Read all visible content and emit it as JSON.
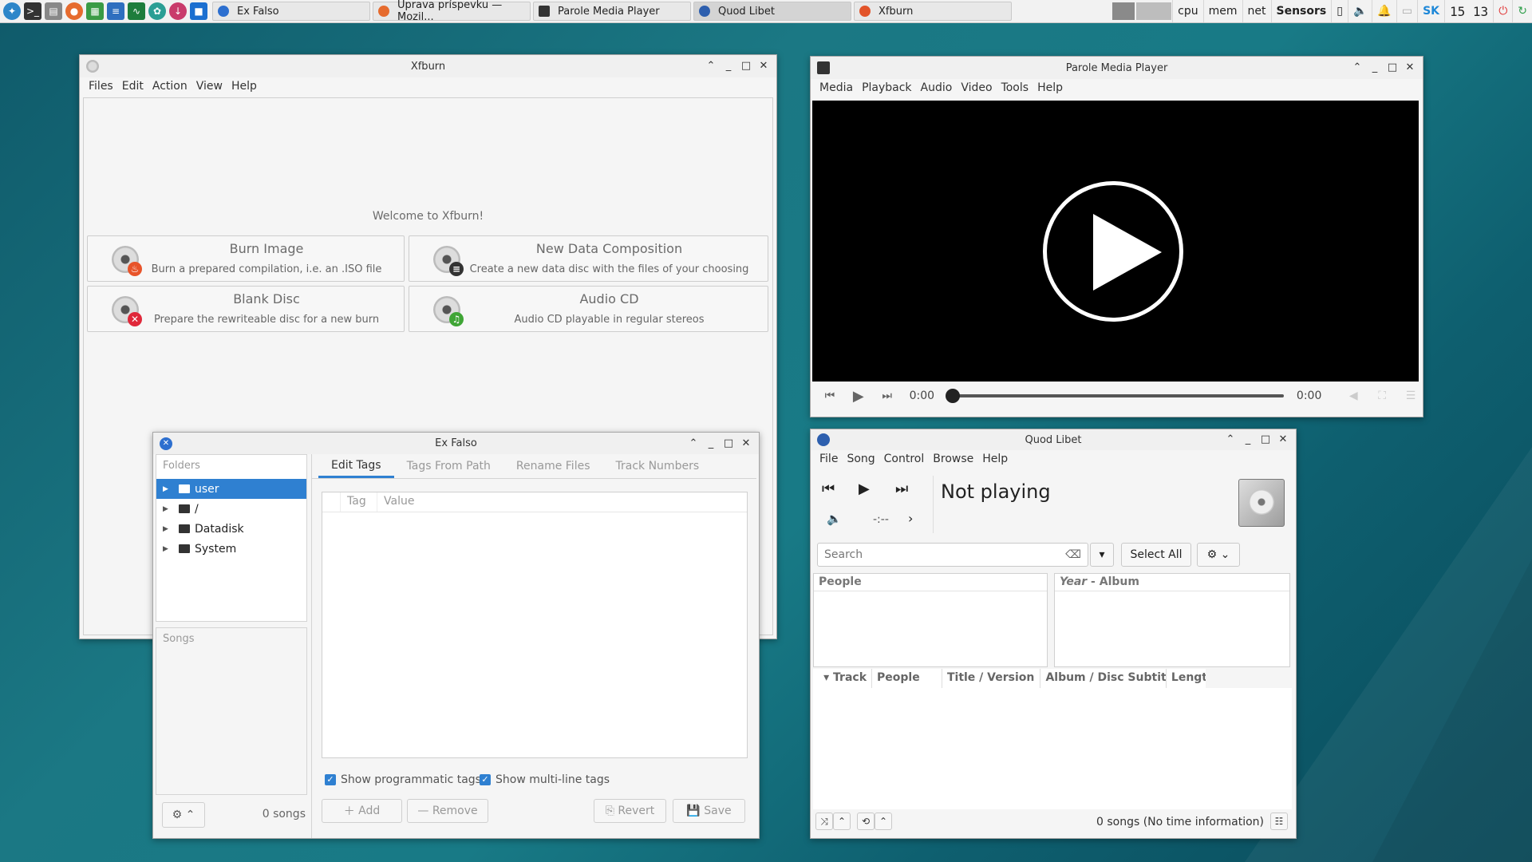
{
  "taskbar": {
    "launchers": [
      "app-menu-icon",
      "terminal-icon",
      "file-manager-icon",
      "firefox-icon",
      "spreadsheet-icon",
      "document-icon",
      "activity-monitor-icon",
      "settings-icon",
      "download-icon",
      "desktop-icon"
    ],
    "tasks": [
      {
        "label": "Ex Falso",
        "icon": "exfalso-icon",
        "color": "#2d6fcf"
      },
      {
        "label": "Úprava príspevku — Mozil...",
        "icon": "firefox-icon",
        "color": "#e66b2e"
      },
      {
        "label": "Parole Media Player",
        "icon": "parole-icon",
        "color": "#333333"
      },
      {
        "label": "Quod Libet",
        "icon": "quodlibet-icon",
        "color": "#2d5fae"
      },
      {
        "label": "Xfburn",
        "icon": "xfburn-icon",
        "color": "#e2542a"
      }
    ],
    "tray": {
      "cpu": "cpu",
      "mem": "mem",
      "net": "net",
      "sensors": "Sensors",
      "keyboard_layout": "SK",
      "clock": "15 13"
    }
  },
  "xfburn": {
    "title": "Xfburn",
    "menu": [
      "Files",
      "Edit",
      "Action",
      "View",
      "Help"
    ],
    "welcome": "Welcome to Xfburn!",
    "cards": [
      {
        "title": "Burn Image",
        "desc": "Burn a prepared compilation, i.e. an .ISO file"
      },
      {
        "title": "New Data Composition",
        "desc": "Create a new data disc with the files of your choosing"
      },
      {
        "title": "Blank Disc",
        "desc": "Prepare the rewriteable disc for a new burn"
      },
      {
        "title": "Audio CD",
        "desc": "Audio CD playable in regular stereos"
      }
    ]
  },
  "parole": {
    "title": "Parole Media Player",
    "menu": [
      "Media",
      "Playback",
      "Audio",
      "Video",
      "Tools",
      "Help"
    ],
    "elapsed": "0:00",
    "duration": "0:00",
    "progress": 0
  },
  "exfalso": {
    "title": "Ex Falso",
    "folders_label": "Folders",
    "folders": [
      "user",
      "/",
      "Datadisk",
      "System"
    ],
    "songs_label": "Songs",
    "songs_count": "0 songs",
    "tabs": [
      "Edit Tags",
      "Tags From Path",
      "Rename Files",
      "Track Numbers"
    ],
    "tag_col": "Tag",
    "value_col": "Value",
    "show_programmatic": "Show programmatic tags",
    "show_multiline": "Show multi-line tags",
    "add": "Add",
    "remove": "Remove",
    "revert": "Revert",
    "save": "Save"
  },
  "quodlibet": {
    "title": "Quod Libet",
    "menu": [
      "File",
      "Song",
      "Control",
      "Browse",
      "Help"
    ],
    "status": "Not playing",
    "time": "-:--",
    "search_placeholder": "Search",
    "select_all": "Select All",
    "people_pane": "People",
    "year_pane": "Year",
    "album_pane": " - Album",
    "columns": [
      "Track",
      "People",
      "Title / Version",
      "Album / Disc Subtitle",
      "Lengt"
    ],
    "footer": "0 songs (No time information)"
  }
}
